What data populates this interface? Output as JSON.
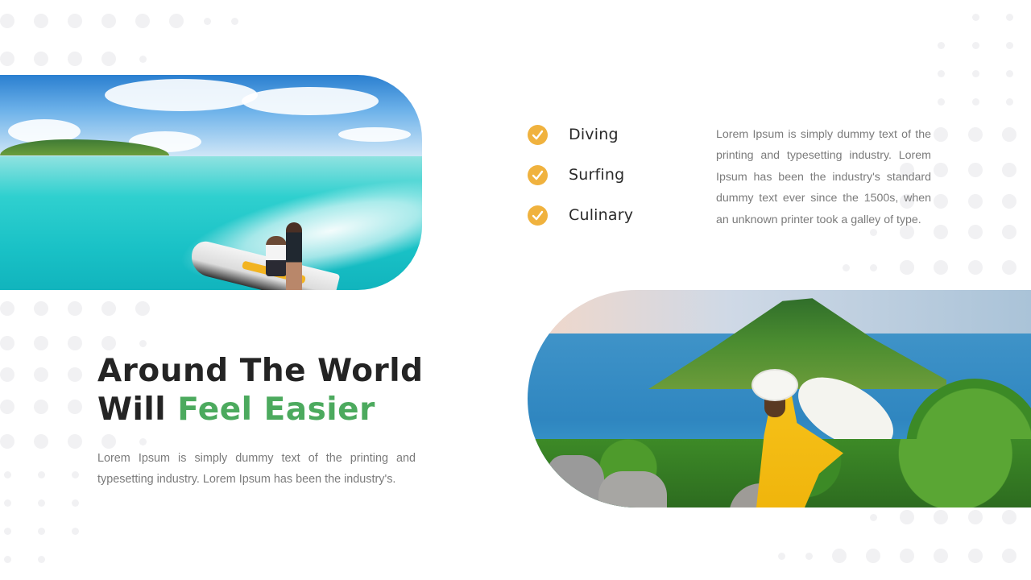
{
  "slide": {
    "headline": {
      "line1": "Around The World",
      "line2_prefix": "Will",
      "line2_accent": "Feel Easier"
    },
    "left_paragraph": "Lorem Ipsum is simply dummy text of the printing and typesetting industry.  Lorem Ipsum has been the industry's.",
    "checklist": [
      {
        "label": "Diving",
        "icon": "check-circle-icon"
      },
      {
        "label": "Surfing",
        "icon": "check-circle-icon"
      },
      {
        "label": "Culinary",
        "icon": "check-circle-icon"
      }
    ],
    "right_paragraph": "Lorem Ipsum is simply dummy text of the printing and typesetting industry.  Lorem Ipsum has been the industry's standard dummy text ever since the 1500s,  when an unknown printer took a galley of type.",
    "images": {
      "top_left": "jet-ski-photo",
      "bottom_right": "island-viewpoint-photo"
    },
    "colors": {
      "accent_green": "#4caa5e",
      "check_orange": "#f0b23e",
      "heading_dark": "#242424",
      "body_gray": "#7b7b7b",
      "dot_gray": "#f1f1f3"
    }
  }
}
